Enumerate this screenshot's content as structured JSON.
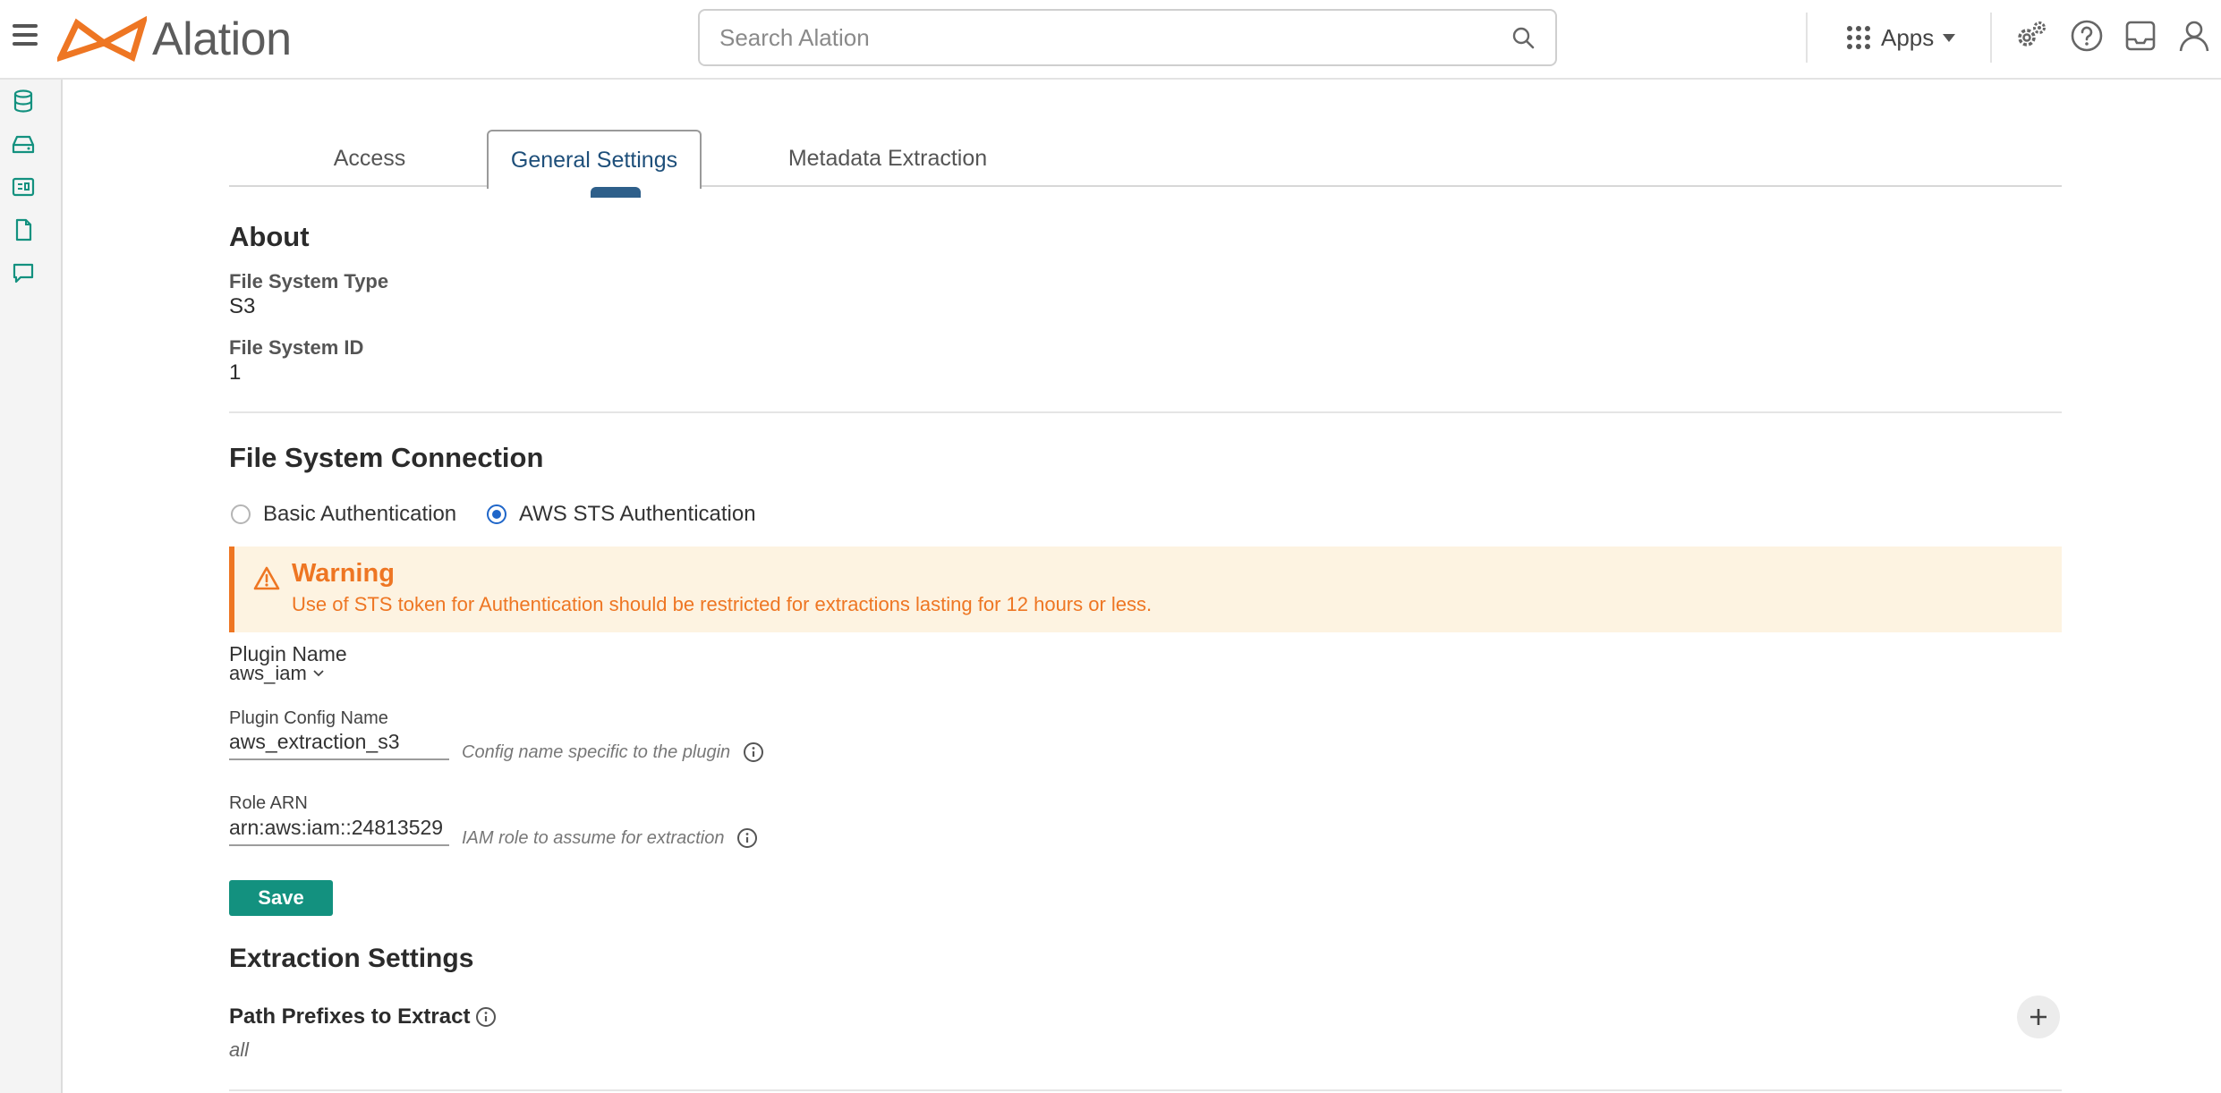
{
  "header": {
    "logo_text": "Alation",
    "search_placeholder": "Search Alation",
    "apps_label": "Apps"
  },
  "tabs": [
    {
      "label": "Access",
      "active": false
    },
    {
      "label": "General Settings",
      "active": true
    },
    {
      "label": "Metadata Extraction",
      "active": false
    }
  ],
  "about": {
    "title": "About",
    "fields": [
      {
        "label": "File System Type",
        "value": "S3"
      },
      {
        "label": "File System ID",
        "value": "1"
      }
    ]
  },
  "connection": {
    "title": "File System Connection",
    "auth_options": [
      {
        "label": "Basic Authentication",
        "selected": false
      },
      {
        "label": "AWS STS Authentication",
        "selected": true
      }
    ],
    "warning": {
      "title": "Warning",
      "text": "Use of STS token for Authentication should be restricted for extractions lasting for 12 hours or less."
    },
    "plugin_name": {
      "label": "Plugin Name",
      "value": "aws_iam"
    },
    "plugin_config": {
      "label": "Plugin Config Name",
      "value": "aws_extraction_s3",
      "hint": "Config name specific to the plugin"
    },
    "role_arn": {
      "label": "Role ARN",
      "value": "arn:aws:iam::24813529",
      "hint": "IAM role to assume for extraction"
    },
    "save_label": "Save"
  },
  "extraction": {
    "title": "Extraction Settings",
    "path_prefixes": {
      "label": "Path Prefixes to Extract",
      "value": "all"
    }
  },
  "colors": {
    "brand_orange": "#ee7623",
    "teal": "#13917f",
    "tab_active_text": "#1e4f7a",
    "radio_blue": "#1f66c9",
    "warning_bg": "#fdf3e1"
  }
}
